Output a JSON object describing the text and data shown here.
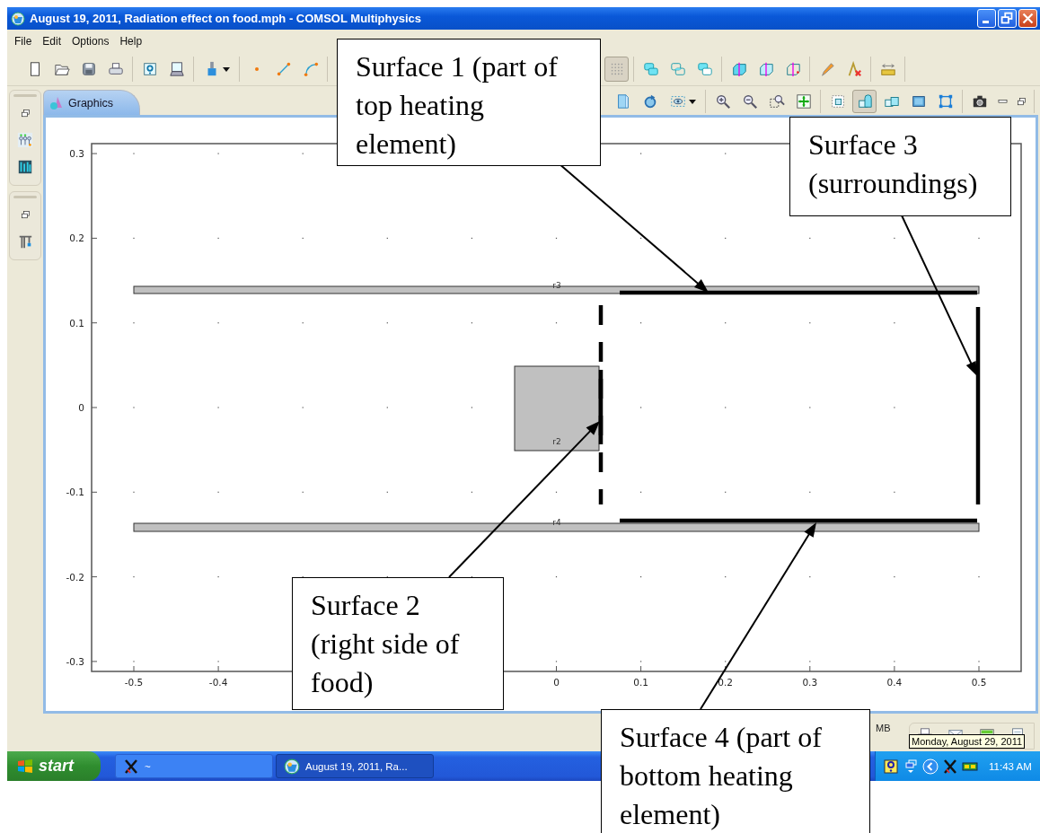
{
  "window": {
    "title": "August 19, 2011, Radiation effect on food.mph - COMSOL Multiphysics"
  },
  "menu": [
    "File",
    "Edit",
    "Options",
    "Help"
  ],
  "main_toolbar_left": [
    [
      {
        "kind": "new",
        "pressed": false
      },
      {
        "kind": "open",
        "pressed": false
      },
      {
        "kind": "save",
        "pressed": false
      },
      {
        "kind": "print",
        "pressed": false
      }
    ],
    [
      {
        "kind": "help",
        "pressed": false
      },
      {
        "kind": "monitor",
        "pressed": false
      }
    ],
    [
      {
        "kind": "brush",
        "pressed": false
      }
    ],
    [
      {
        "kind": "point",
        "pressed": false
      },
      {
        "kind": "line",
        "pressed": false
      },
      {
        "kind": "curve",
        "pressed": false
      }
    ]
  ],
  "main_toolbar_right": [
    [
      {
        "kind": "grid",
        "pressed": true
      }
    ],
    [
      {
        "kind": "union",
        "pressed": false
      },
      {
        "kind": "intersect",
        "pressed": false
      },
      {
        "kind": "difference",
        "pressed": false
      }
    ],
    [
      {
        "kind": "cube1",
        "pressed": false
      },
      {
        "kind": "cube2",
        "pressed": false
      },
      {
        "kind": "cube3",
        "pressed": false
      }
    ],
    [
      {
        "kind": "pencil",
        "pressed": false
      },
      {
        "kind": "delete",
        "pressed": false
      }
    ],
    [
      {
        "kind": "ruler",
        "pressed": false
      }
    ]
  ],
  "sidebar": [
    [
      {
        "kind": "restore"
      },
      {
        "kind": "nodes"
      },
      {
        "kind": "bars"
      }
    ],
    [
      {
        "kind": "restore"
      },
      {
        "kind": "tree"
      }
    ]
  ],
  "graphics_tab": {
    "label": "Graphics",
    "selected": true
  },
  "graphics_toolbar": [
    [
      {
        "kind": "view",
        "pressed": false
      },
      {
        "kind": "rotate",
        "pressed": false
      },
      {
        "kind": "eye",
        "pressed": false
      }
    ],
    [
      {
        "kind": "zoomin",
        "pressed": false
      },
      {
        "kind": "zoomout",
        "pressed": false
      },
      {
        "kind": "zoombox",
        "pressed": false
      },
      {
        "kind": "extents",
        "pressed": false
      }
    ],
    [
      {
        "kind": "select1",
        "pressed": false
      },
      {
        "kind": "select2",
        "pressed": true
      },
      {
        "kind": "select3",
        "pressed": false
      },
      {
        "kind": "select4",
        "pressed": false
      },
      {
        "kind": "select5",
        "pressed": false
      }
    ],
    [
      {
        "kind": "camera",
        "pressed": false
      },
      {
        "kind": "minimize",
        "pressed": false
      },
      {
        "kind": "restore",
        "pressed": false
      }
    ]
  ],
  "plot": {
    "xticks": [
      "-0.5",
      "-0.4",
      "0",
      "0.1",
      "0.2",
      "0.3",
      "0.4",
      "0.5"
    ],
    "yticks": [
      "0.3",
      "0.2",
      "0.1",
      "0",
      "-0.1",
      "-0.2",
      "-0.3"
    ],
    "shape_labels": [
      "r3",
      "r2",
      "r4"
    ]
  },
  "status": {
    "memory": "MB"
  },
  "tooltip": "Monday, August 29, 2011",
  "taskbar": {
    "start": "start",
    "tasks": [
      {
        "kind": "xterm",
        "label": "~",
        "selected": false
      },
      {
        "kind": "app",
        "label": "August 19, 2011, Ra...",
        "selected": true
      }
    ],
    "clock": "11:43 AM"
  },
  "callouts": [
    {
      "text": "Surface 1 (part of top heating element)"
    },
    {
      "text": "Surface 3 (surroundings)"
    },
    {
      "text": "Surface 2 (right side of food)"
    },
    {
      "text": "Surface 4 (part of bottom heating element)"
    }
  ]
}
